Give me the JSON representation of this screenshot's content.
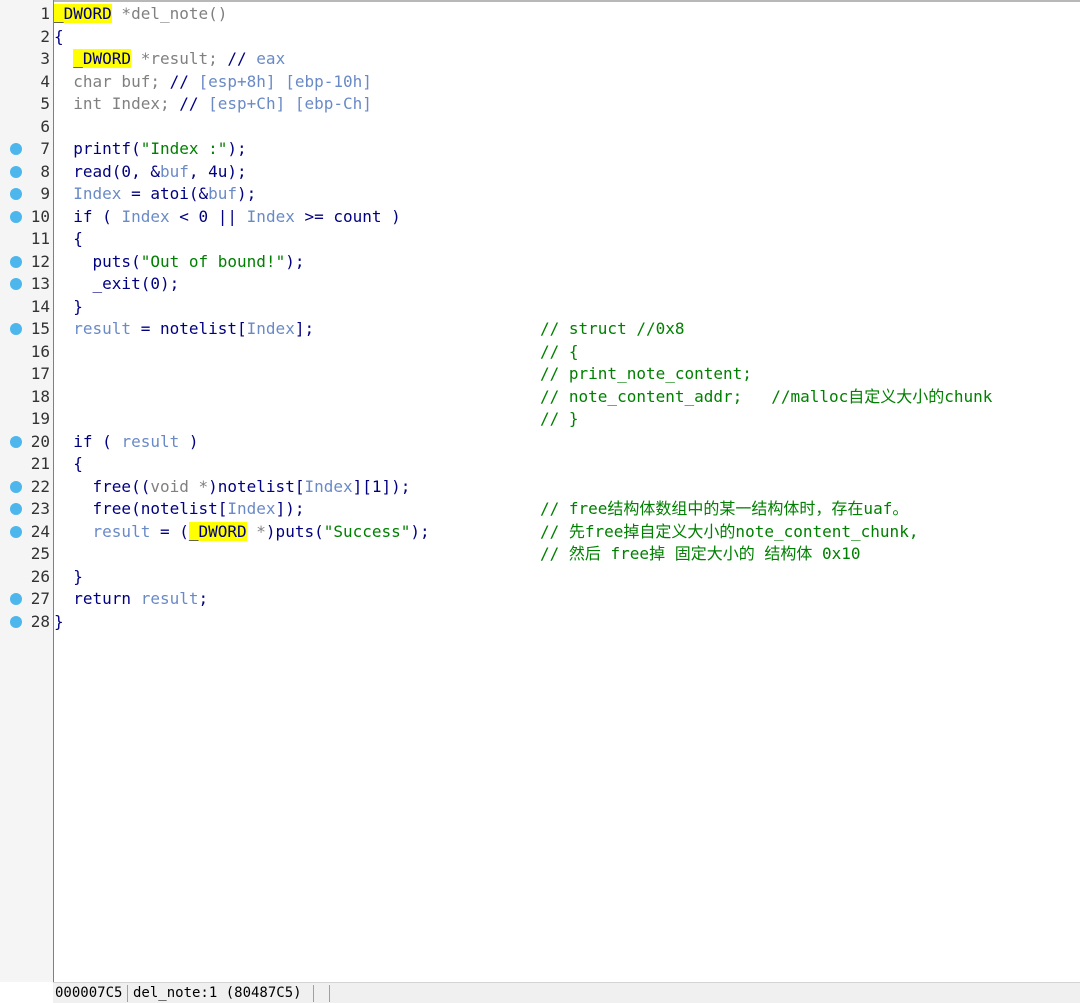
{
  "lines": [
    {
      "n": "1",
      "bp": false,
      "code": [
        [
          "hl",
          "_DWORD"
        ],
        [
          "grey",
          " *del_note()"
        ]
      ]
    },
    {
      "n": "2",
      "bp": false,
      "code": [
        [
          "",
          "{"
        ]
      ]
    },
    {
      "n": "3",
      "bp": false,
      "code": [
        [
          "",
          "  "
        ],
        [
          "hl",
          "_DWORD"
        ],
        [
          "grey",
          " *result; "
        ],
        [
          "",
          "// "
        ],
        [
          "var",
          "eax"
        ]
      ]
    },
    {
      "n": "4",
      "bp": false,
      "code": [
        [
          "grey",
          "  char buf; "
        ],
        [
          "",
          "// "
        ],
        [
          "var",
          "[esp+8h] [ebp-10h]"
        ]
      ]
    },
    {
      "n": "5",
      "bp": false,
      "code": [
        [
          "grey",
          "  int Index; "
        ],
        [
          "",
          "// "
        ],
        [
          "var",
          "[esp+Ch] [ebp-Ch]"
        ]
      ]
    },
    {
      "n": "6",
      "bp": false,
      "code": []
    },
    {
      "n": "7",
      "bp": true,
      "code": [
        [
          "",
          "  printf("
        ],
        [
          "str",
          "\"Index :\""
        ],
        [
          "",
          ");"
        ]
      ]
    },
    {
      "n": "8",
      "bp": true,
      "code": [
        [
          "",
          "  read(0, &"
        ],
        [
          "var",
          "buf"
        ],
        [
          "",
          ", 4u);"
        ]
      ]
    },
    {
      "n": "9",
      "bp": true,
      "code": [
        [
          "",
          "  "
        ],
        [
          "var",
          "Index"
        ],
        [
          "",
          " = atoi(&"
        ],
        [
          "var",
          "buf"
        ],
        [
          "",
          ");"
        ]
      ]
    },
    {
      "n": "10",
      "bp": true,
      "code": [
        [
          "",
          "  if ( "
        ],
        [
          "var",
          "Index"
        ],
        [
          "",
          " < 0 || "
        ],
        [
          "var",
          "Index"
        ],
        [
          "",
          " >= count )"
        ]
      ]
    },
    {
      "n": "11",
      "bp": false,
      "code": [
        [
          "",
          "  {"
        ]
      ]
    },
    {
      "n": "12",
      "bp": true,
      "code": [
        [
          "",
          "    puts("
        ],
        [
          "str",
          "\"Out of bound!\""
        ],
        [
          "",
          ");"
        ]
      ]
    },
    {
      "n": "13",
      "bp": true,
      "code": [
        [
          "",
          "    _exit(0);"
        ]
      ]
    },
    {
      "n": "14",
      "bp": false,
      "code": [
        [
          "",
          "  }"
        ]
      ]
    },
    {
      "n": "15",
      "bp": true,
      "code": [
        [
          "",
          "  "
        ],
        [
          "var",
          "result"
        ],
        [
          "",
          " = notelist["
        ],
        [
          "var",
          "Index"
        ],
        [
          "",
          "];"
        ]
      ],
      "comment": "// struct //0x8"
    },
    {
      "n": "16",
      "bp": false,
      "code": [],
      "comment": "// {"
    },
    {
      "n": "17",
      "bp": false,
      "code": [],
      "comment": "// print_note_content;"
    },
    {
      "n": "18",
      "bp": false,
      "code": [],
      "comment": "// note_content_addr;   //malloc自定义大小的chunk"
    },
    {
      "n": "19",
      "bp": false,
      "code": [],
      "comment": "// }"
    },
    {
      "n": "20",
      "bp": true,
      "code": [
        [
          "",
          "  if ( "
        ],
        [
          "var",
          "result"
        ],
        [
          "",
          " )"
        ]
      ]
    },
    {
      "n": "21",
      "bp": false,
      "code": [
        [
          "",
          "  {"
        ]
      ]
    },
    {
      "n": "22",
      "bp": true,
      "code": [
        [
          "",
          "    free(("
        ],
        [
          "grey",
          "void *"
        ],
        [
          "",
          ")notelist["
        ],
        [
          "var",
          "Index"
        ],
        [
          "",
          "][1]);"
        ]
      ]
    },
    {
      "n": "23",
      "bp": true,
      "code": [
        [
          "",
          "    free(notelist["
        ],
        [
          "var",
          "Index"
        ],
        [
          "",
          "]);"
        ]
      ],
      "comment": "// free结构体数组中的某一结构体时，存在uaf。"
    },
    {
      "n": "24",
      "bp": true,
      "code": [
        [
          "",
          "    "
        ],
        [
          "var",
          "result"
        ],
        [
          "",
          " = ("
        ],
        [
          "hl",
          "_DWORD"
        ],
        [
          "grey",
          " *"
        ],
        [
          "",
          ")puts("
        ],
        [
          "str",
          "\"Success\""
        ],
        [
          "",
          ");"
        ]
      ],
      "comment": "// 先free掉自定义大小的note_content_chunk,"
    },
    {
      "n": "25",
      "bp": false,
      "code": [],
      "comment": "// 然后 free掉 固定大小的 结构体 0x10"
    },
    {
      "n": "26",
      "bp": false,
      "code": [
        [
          "",
          "  }"
        ]
      ]
    },
    {
      "n": "27",
      "bp": true,
      "code": [
        [
          "",
          "  return "
        ],
        [
          "var",
          "result"
        ],
        [
          "",
          ";"
        ]
      ]
    },
    {
      "n": "28",
      "bp": true,
      "code": [
        [
          "",
          "}"
        ]
      ]
    }
  ],
  "colors": {
    "keyword": "#000080",
    "comment": "#008000",
    "variable": "#6a8ac6",
    "type_grey": "#808080",
    "highlight": "#ffff00",
    "breakpoint": "#4db6ec"
  },
  "statusbar": {
    "address": "000007C5",
    "location": "del_note:1 (80487C5)"
  }
}
